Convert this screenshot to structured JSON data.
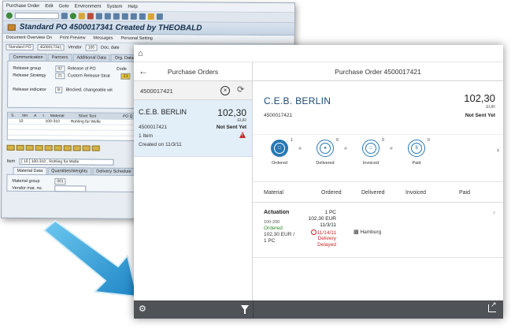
{
  "sap": {
    "menu": [
      "Purchase Order",
      "Edit",
      "Goto",
      "Environment",
      "System",
      "Help"
    ],
    "title": "Standard PO 4500017341 Created by THEOBALD",
    "appbar": [
      "Document Overview On",
      "Print Preview",
      "Messages",
      "Personal Setting"
    ],
    "header": {
      "doc_type": "Standard PO",
      "po_number": "4500017341",
      "vendor_label": "Vendor",
      "vendor_value": "100",
      "doc_date": "Doc. date"
    },
    "tabs": [
      "Communication",
      "Partners",
      "Additional Data",
      "Org. Data"
    ],
    "release": [
      {
        "label": "Release group",
        "code": "02",
        "text": "Release of PO"
      },
      {
        "label": "Release Strategy",
        "code": "21",
        "text": "Custom Release Strat"
      },
      {
        "label": "Release indicator",
        "code": "B",
        "text": "Blocked, changeable wit"
      }
    ],
    "code_label": "Code",
    "code_value": "Z1",
    "grid_headers": [
      "S..",
      "Itm",
      "A",
      "I",
      "Material",
      "Short Text",
      "PO Q"
    ],
    "grid_row": {
      "item": "10",
      "material": "100-310",
      "short_text": "Rohling für Welle"
    },
    "item_label": "Item",
    "item_value": "[ 10 ] 100-310 , Rohling für Welle",
    "subtabs": [
      "Material Data",
      "Quantities/Weights",
      "Delivery Schedule"
    ],
    "material_group_label": "Material group",
    "material_group_value": "001",
    "vendor_mat_label": "Vendor mat. no."
  },
  "fiori": {
    "master": {
      "title": "Purchase Orders",
      "search_value": "4500017421",
      "item": {
        "vendor": "C.E.B. BERLIN",
        "amount": "102,30",
        "currency": "EUR",
        "po_number": "4500017421",
        "status": "Not Sent Yet",
        "items": "1 Item",
        "created": "Created on 11/3/11"
      }
    },
    "detail": {
      "title": "Purchase Order 4500017421",
      "vendor": "C.E.B. BERLIN",
      "po_number": "4500017421",
      "amount": "102,30",
      "currency": "EUR",
      "status": "Not Sent Yet",
      "process": [
        {
          "label": "Ordered",
          "count": "1"
        },
        {
          "label": "Delivered",
          "count": "0"
        },
        {
          "label": "Invoiced",
          "count": "0"
        },
        {
          "label": "Paid",
          "count": "0"
        }
      ],
      "columns": [
        "Material",
        "Ordered",
        "Delivered",
        "Invoiced",
        "Paid"
      ],
      "row": {
        "material": "Actuation",
        "material_id": "100-200",
        "status": "Ordered",
        "amount": "102,30 EUR /",
        "qty": "1 PC",
        "ordered_qty": "1 PC",
        "ordered_amount": "102,30 EUR",
        "ordered_date": "11/3/11",
        "delivery_date": "11/14/11",
        "delivery_status_1": "Delivery",
        "delivery_status_2": "Delayed",
        "plant": "Hamburg"
      }
    }
  },
  "colors": {
    "accent": "#2878b4",
    "selection": "#e2eef8",
    "footer": "#4f5256",
    "alert": "#c62828",
    "success": "#2c8a2c",
    "arrow": "#2f9fd8"
  }
}
